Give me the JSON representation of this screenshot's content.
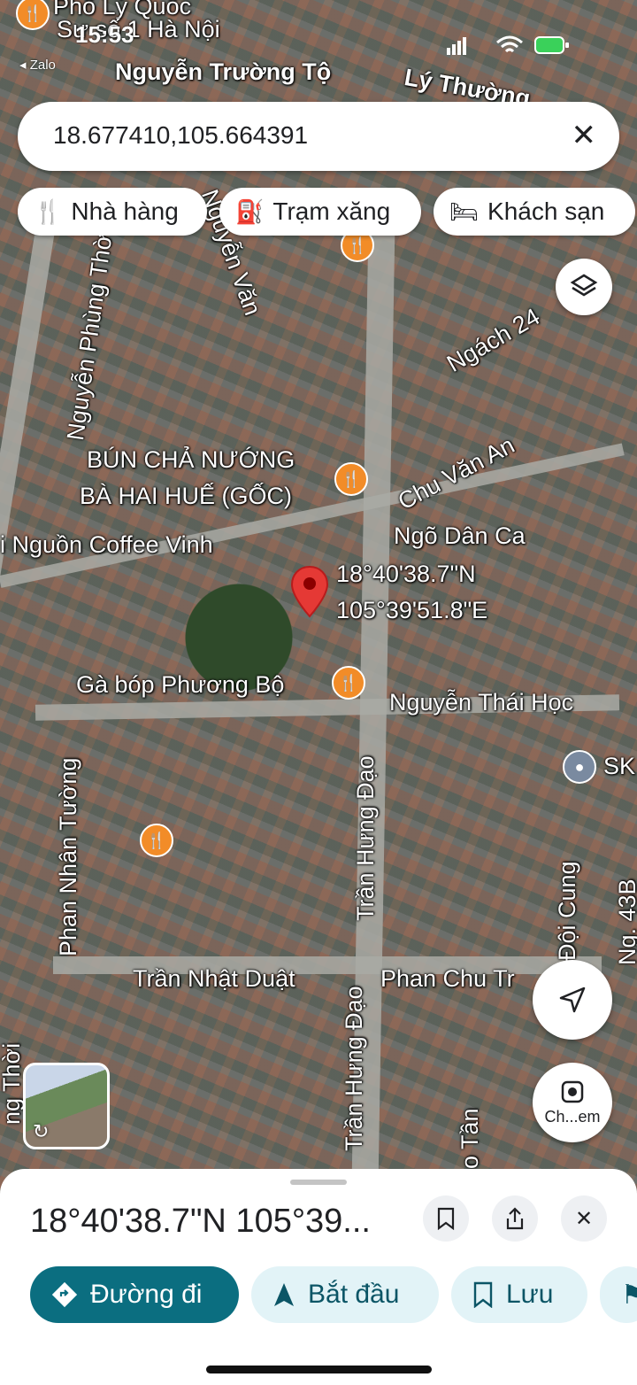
{
  "status": {
    "time": "15:53",
    "back_app": "◂ Zalo"
  },
  "search": {
    "value": "18.677410,105.664391"
  },
  "chips": [
    {
      "label": "Nhà hàng",
      "icon": "restaurant-icon"
    },
    {
      "label": "Trạm xăng",
      "icon": "gas-station-icon"
    },
    {
      "label": "Khách sạn",
      "icon": "hotel-icon"
    }
  ],
  "map": {
    "labels": {
      "top1": "Phố Lý Quốc",
      "top2": "Sư số 1 Hà Nội",
      "nguyen_truong_to": "Nguyễn Trường Tộ",
      "ly_thuong": "Lý Thường...",
      "nguyen_van": "Nguyễn Văn",
      "nguyen_phung_thoi": "Nguyễn Phùng Thời",
      "ngach24": "Ngách 24",
      "bun_cha": "BÚN CHẢ NƯỚNG",
      "bun_cha2": "BÀ HAI HUẾ (GỐC)",
      "chu_van_an": "Chu Văn An",
      "coffee": "i Nguồn Coffee Vinh",
      "ngo_dan_ca": "Ngõ Dân Ca",
      "coord_lat": "18°40'38.7\"N",
      "coord_lng": "105°39'51.8\"E",
      "ga_bop": "Gà bóp Phương Bộ",
      "nguyen_thai_hoc": "Nguyễn Thái Học",
      "phan_nhan_tuong": "Phan Nhân Tường",
      "tran_hung_dao": "Trần Hưng Đạo",
      "tran_hung_dao2": "Trần Hưng Đạo",
      "doi_cung": "Đội Cung",
      "ng43b": "Ng. 43B",
      "sk": "SK",
      "tran_nhat_duat": "Trần Nhật Duật",
      "phan_chu_trinh": "Phan Chu Tr",
      "go_tan": "o Tần",
      "ng_thoi": "ng Thời"
    }
  },
  "lens": {
    "label": "Ch...em"
  },
  "sheet": {
    "title": "18°40'38.7\"N 105°39...",
    "buttons": [
      {
        "label": "Đường đi",
        "icon": "directions-icon"
      },
      {
        "label": "Bắt đầu",
        "icon": "navigate-icon"
      },
      {
        "label": "Lưu",
        "icon": "bookmark-icon"
      }
    ]
  },
  "colors": {
    "primary": "#0b6e80",
    "chip_bg": "#e2f3f7",
    "pin": "#e53935",
    "poi": "#f28c28"
  }
}
